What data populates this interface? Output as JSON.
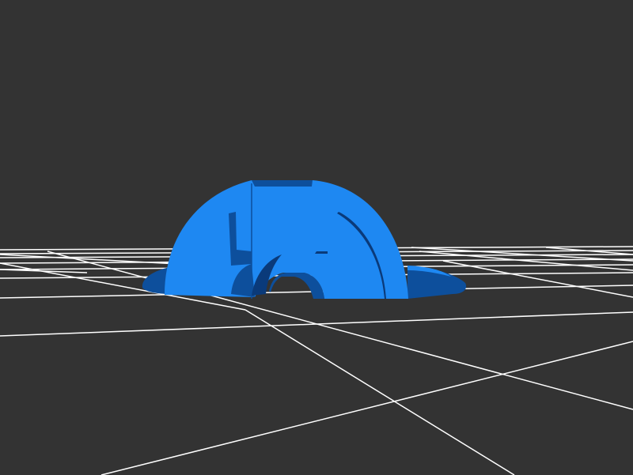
{
  "viewer": {
    "background_color": "#333333",
    "grid_color": "#ffffff",
    "grid_visible": true,
    "model": {
      "name": "",
      "color": "#1e88f2",
      "shadow_color": "#0d4f9c",
      "dark_color": "#0a3a7a",
      "shape": "half-dome-arch"
    }
  }
}
